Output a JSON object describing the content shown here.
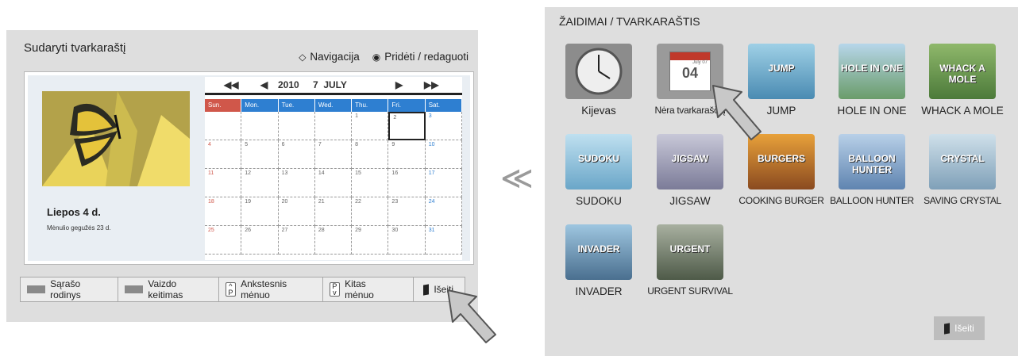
{
  "left": {
    "title": "Sudaryti tvarkaraštį",
    "mode_nav": "Navigacija",
    "mode_edit": "Pridėti / redaguoti",
    "photo_date": "Liepos 4 d.",
    "photo_sub": "Mėnulio gegužės 23 d.",
    "calendar": {
      "year": "2010",
      "month": "7  JULY",
      "weekdays": [
        "Sun.",
        "Mon.",
        "Tue.",
        "Wed.",
        "Thu.",
        "Fri.",
        "Sat."
      ],
      "days": [
        "",
        "",
        "",
        "",
        "1",
        "2",
        "3",
        "4",
        "5",
        "6",
        "7",
        "8",
        "9",
        "10",
        "11",
        "12",
        "13",
        "14",
        "15",
        "16",
        "17",
        "18",
        "19",
        "20",
        "21",
        "22",
        "23",
        "24",
        "25",
        "26",
        "27",
        "28",
        "29",
        "30",
        "31"
      ]
    },
    "bottom": {
      "list_view": "Sąrašo rodinys",
      "view_change": "Vaizdo keitimas",
      "prev_key": "P",
      "prev_month": "Ankstesnis mėnuo",
      "next_key": "P",
      "next_month": "Kitas mėnuo",
      "exit": "Išeiti"
    }
  },
  "separator": "≪",
  "right": {
    "title": "ŽAIDIMAI / TVARKARAŠTIS",
    "games": [
      {
        "label": "Kijevas",
        "icon": "clock-icon"
      },
      {
        "label": "Nėra tvarkaraščių",
        "icon": "calendar-icon",
        "date_num": "04",
        "date_small": "July 07"
      },
      {
        "label": "JUMP",
        "icon": "jump-icon",
        "thumb_text": "JUMP"
      },
      {
        "label": "HOLE IN ONE",
        "icon": "hole-in-one-icon",
        "thumb_text": "HOLE IN ONE"
      },
      {
        "label": "WHACK A MOLE",
        "icon": "whack-a-mole-icon",
        "thumb_text": "WHACK A MOLE"
      },
      {
        "label": "SUDOKU",
        "icon": "sudoku-icon",
        "thumb_text": "SUDOKU"
      },
      {
        "label": "JIGSAW",
        "icon": "jigsaw-icon",
        "thumb_text": "JIGSAW"
      },
      {
        "label": "COOKING BURGER",
        "icon": "cooking-burger-icon",
        "thumb_text": "BURGERS"
      },
      {
        "label": "BALLOON HUNTER",
        "icon": "balloon-hunter-icon",
        "thumb_text": "BALLOON HUNTER"
      },
      {
        "label": "SAVING CRYSTAL",
        "icon": "saving-crystal-icon",
        "thumb_text": "CRYSTAL"
      },
      {
        "label": "INVADER",
        "icon": "invader-icon",
        "thumb_text": "INVADER"
      },
      {
        "label": "URGENT SURVIVAL",
        "icon": "urgent-survival-icon",
        "thumb_text": "URGENT"
      }
    ],
    "exit": "Išeiti"
  },
  "colors": {
    "panel_bg": "#dedede",
    "weekday_blue": "#2e7fd1",
    "sunday_red": "#d0574a",
    "separator_gray": "#9a9a9a"
  }
}
